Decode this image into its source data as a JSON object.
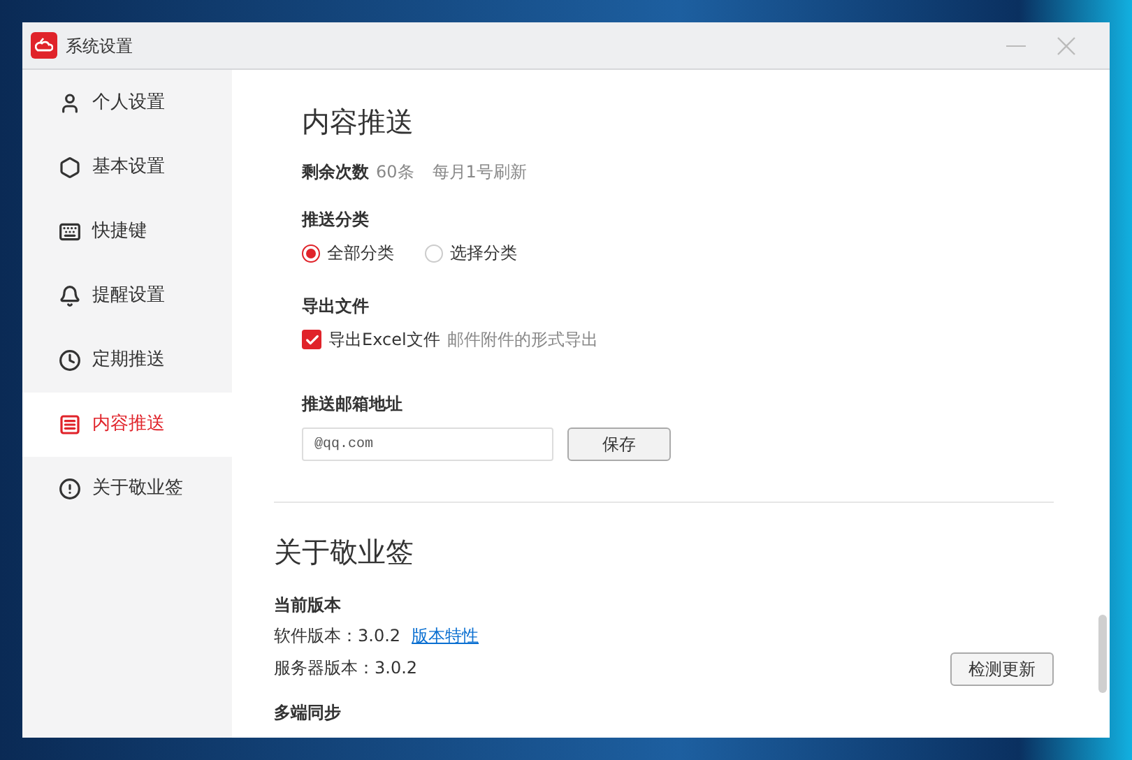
{
  "window": {
    "title": "系统设置"
  },
  "sidebar": {
    "items": [
      {
        "label": "个人设置",
        "kind": "user",
        "selected": false
      },
      {
        "label": "基本设置",
        "kind": "basic",
        "selected": false
      },
      {
        "label": "快捷键",
        "kind": "keyboard",
        "selected": false
      },
      {
        "label": "提醒设置",
        "kind": "bell",
        "selected": false
      },
      {
        "label": "定期推送",
        "kind": "clock",
        "selected": false
      },
      {
        "label": "内容推送",
        "kind": "content",
        "selected": true
      },
      {
        "label": "关于敬业签",
        "kind": "info",
        "selected": false
      }
    ]
  },
  "content_push": {
    "title": "内容推送",
    "remaining": {
      "label": "剩余次数",
      "count": "60条",
      "note": "每月1号刷新"
    },
    "category": {
      "label": "推送分类",
      "options": [
        {
          "label": "全部分类",
          "selected": true
        },
        {
          "label": "选择分类",
          "selected": false
        }
      ]
    },
    "export": {
      "label": "导出文件",
      "checkbox": {
        "label": "导出Excel文件",
        "checked": true
      },
      "hint": "邮件附件的形式导出"
    },
    "email": {
      "label": "推送邮箱地址",
      "value": "@qq.com",
      "button": "保存"
    }
  },
  "about": {
    "title": "关于敬业签",
    "version": {
      "label": "当前版本",
      "software": "软件版本：3.0.2",
      "link": "版本特性",
      "server": "服务器版本：3.0.2",
      "button": "检测更新"
    },
    "next_section": "多端同步"
  }
}
